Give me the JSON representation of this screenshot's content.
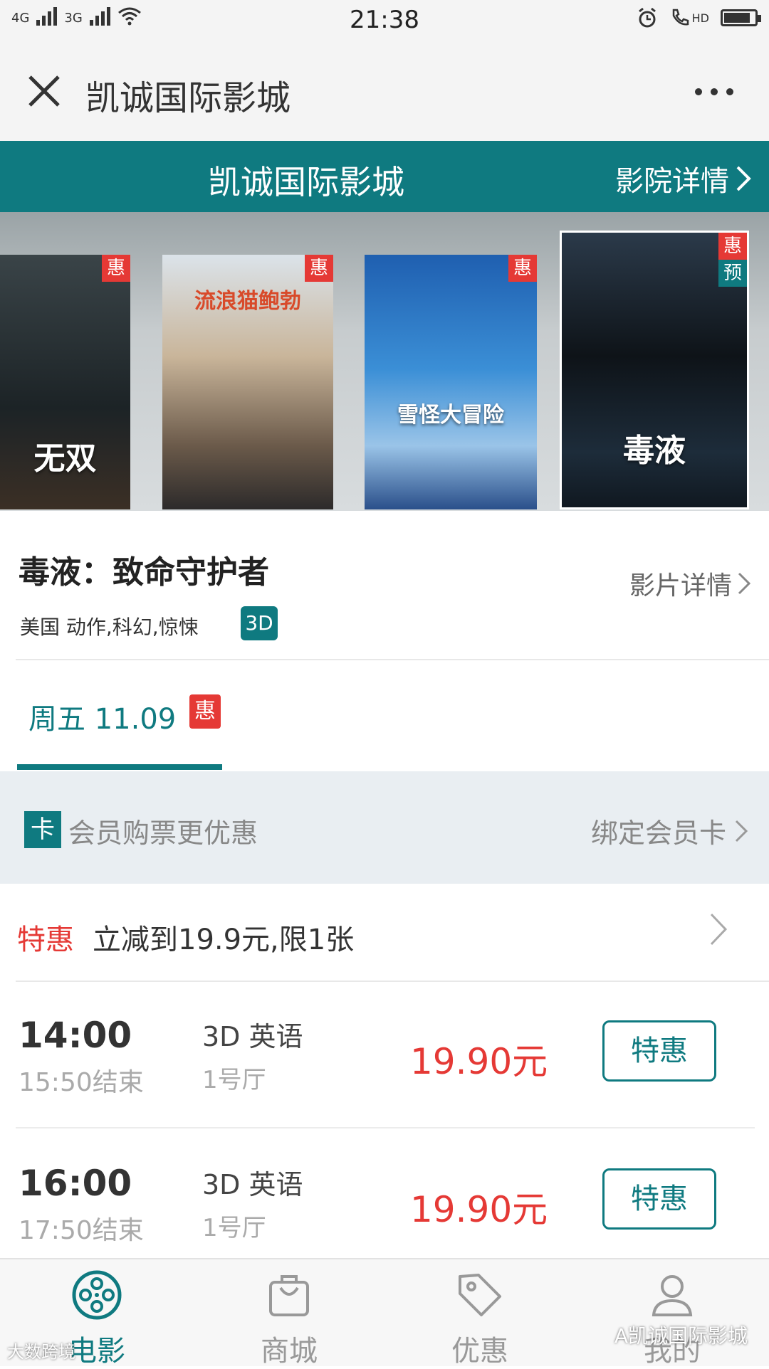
{
  "status": {
    "network1": "4G",
    "network2": "3G",
    "time": "21:38",
    "hd": "HD",
    "battery_level": 0.85
  },
  "titlebar": {
    "title": "凯诚国际影城",
    "close_icon": "close-icon",
    "more_icon": "more-icon"
  },
  "cinema_header": {
    "name": "凯诚国际影城",
    "detail_link": "影院详情"
  },
  "posters": [
    {
      "title": "无双",
      "badge": "惠"
    },
    {
      "title": "流浪猫鲍勃",
      "badge": "惠"
    },
    {
      "title": "雪怪大冒险",
      "badge": "惠"
    },
    {
      "title": "毒液",
      "badge": "惠",
      "badge2": "预"
    }
  ],
  "movie": {
    "title": "毒液：致命守护者",
    "detail_link": "影片详情",
    "meta": "美国 动作,科幻,惊悚",
    "format_tag": "3D"
  },
  "date_tab": {
    "label": "周五 11.09",
    "badge": "惠"
  },
  "member": {
    "card_icon": "卡",
    "text": "会员购票更优惠",
    "bind_link": "绑定会员卡"
  },
  "promo": {
    "label": "特惠",
    "text": "立减到19.9元,限1张"
  },
  "showtimes": [
    {
      "start": "14:00",
      "end": "15:50结束",
      "lang": "3D 英语",
      "hall": "1号厅",
      "price": "19.90元",
      "button": "特惠"
    },
    {
      "start": "16:00",
      "end": "17:50结束",
      "lang": "3D 英语",
      "hall": "1号厅",
      "price": "19.90元",
      "button": "特惠"
    }
  ],
  "bottom_nav": [
    {
      "label": "电影",
      "icon": "film-reel-icon",
      "active": true
    },
    {
      "label": "商城",
      "icon": "shopping-bag-icon",
      "active": false
    },
    {
      "label": "优惠",
      "icon": "tag-icon",
      "active": false
    },
    {
      "label": "我的",
      "icon": "user-icon",
      "active": false
    }
  ],
  "watermarks": {
    "left": "大数跨境",
    "right": "A凯诚国际影城"
  },
  "colors": {
    "accent": "#0f7a80",
    "promo_red": "#e53935"
  }
}
